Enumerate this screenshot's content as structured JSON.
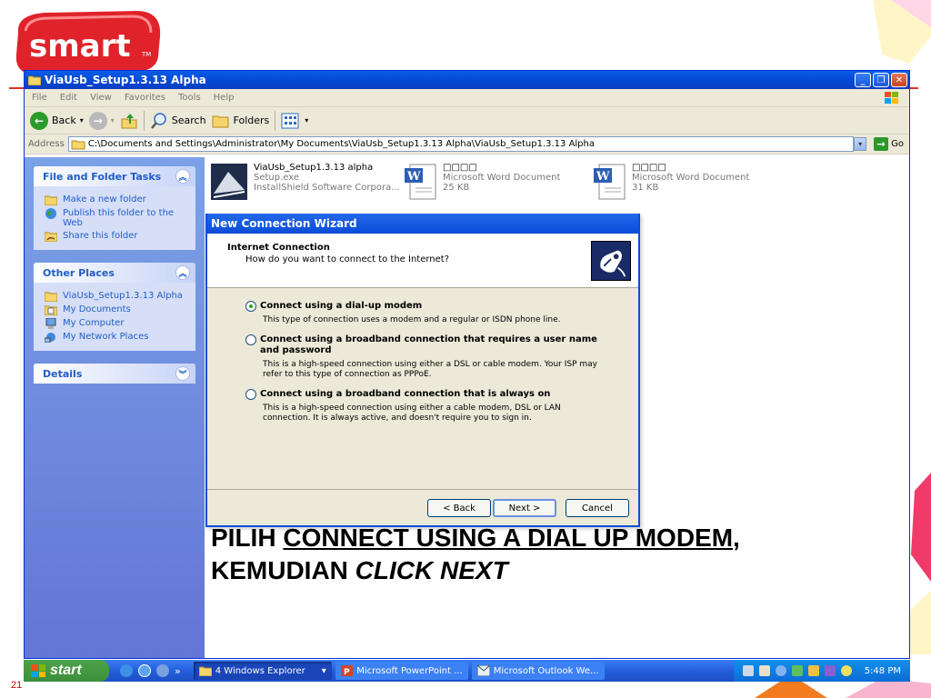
{
  "slide": {
    "logo_text": "smart",
    "logo_tm": "TM",
    "slide_number": "21",
    "caption_line1_a": "PILIH ",
    "caption_line1_b": "CONNECT USING A DIAL UP MODEM",
    "caption_line1_c": ",",
    "caption_line2_a": "KEMUDIAN ",
    "caption_line2_b": "CLICK NEXT"
  },
  "window": {
    "title": "ViaUsb_Setup1.3.13 Alpha",
    "minimize": "_",
    "restore": "❐",
    "close": "✕"
  },
  "menu": [
    "File",
    "Edit",
    "View",
    "Favorites",
    "Tools",
    "Help"
  ],
  "toolbar": {
    "back": "Back",
    "search": "Search",
    "folders": "Folders"
  },
  "address": {
    "label": "Address",
    "path": "C:\\Documents and Settings\\Administrator\\My Documents\\ViaUsb_Setup1.3.13 Alpha\\ViaUsb_Setup1.3.13 Alpha",
    "go": "Go"
  },
  "left_pane": {
    "tasks_title": "File and Folder Tasks",
    "tasks": [
      "Make a new folder",
      "Publish this folder to the Web",
      "Share this folder"
    ],
    "places_title": "Other Places",
    "places": [
      "ViaUsb_Setup1.3.13 Alpha",
      "My Documents",
      "My Computer",
      "My Network Places"
    ],
    "details_title": "Details"
  },
  "files": [
    {
      "name": "ViaUsb_Setup1.3.13 alpha",
      "line2": "Setup.exe",
      "line3": "InstallShield Software Corpora..."
    },
    {
      "name": "□□□□",
      "line2": "Microsoft Word Document",
      "line3": "25 KB"
    },
    {
      "name": "□□□□",
      "line2": "Microsoft Word Document",
      "line3": "31 KB"
    }
  ],
  "wizard": {
    "title": "New Connection Wizard",
    "heading": "Internet Connection",
    "subheading": "How do you want to connect to the Internet?",
    "options": [
      {
        "title": "Connect using a dial-up modem",
        "desc": "This type of connection uses a modem and a regular or ISDN phone line.",
        "selected": true
      },
      {
        "title": "Connect using a broadband connection that requires a user name and password",
        "desc": "This is a high-speed connection using either a DSL or cable modem. Your ISP may refer to this type of connection as PPPoE.",
        "selected": false
      },
      {
        "title": "Connect using a broadband connection that is always on",
        "desc": "This is a high-speed connection using either a cable modem, DSL or LAN connection. It is always active, and doesn't require you to sign in.",
        "selected": false
      }
    ],
    "back": "< Back",
    "next": "Next >",
    "cancel": "Cancel"
  },
  "taskbar": {
    "start": "start",
    "quicklaunch_more": "»",
    "tasks": [
      {
        "label": "4 Windows Explorer",
        "dropdown": "▾"
      },
      {
        "label": "Microsoft PowerPoint ..."
      },
      {
        "label": "Microsoft Outlook We..."
      }
    ],
    "clock": "5:48 PM"
  },
  "colors": {
    "xp_blue": "#0a4cd9",
    "start_green": "#3c8f39",
    "link_blue": "#215dc6",
    "logo_red": "#e0222a"
  }
}
